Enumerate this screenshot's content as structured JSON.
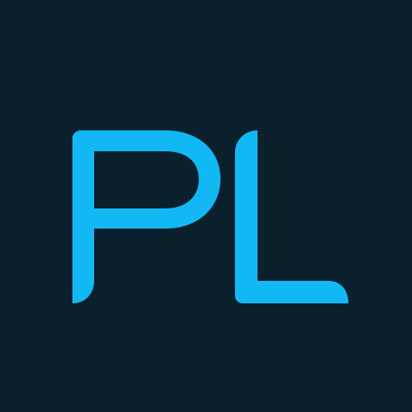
{
  "logo": {
    "text": "PL",
    "icon": "pl-monogram-logo"
  },
  "colors": {
    "background": "#0a202d",
    "glyph": "#12b8f4"
  }
}
